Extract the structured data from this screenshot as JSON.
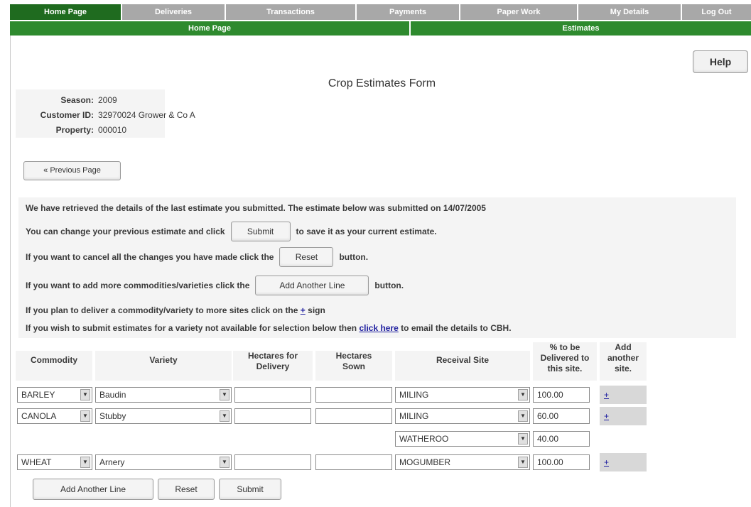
{
  "nav": {
    "tabs": [
      "Home Page",
      "Deliveries",
      "Transactions",
      "Payments",
      "Paper Work",
      "My Details",
      "Log Out"
    ],
    "subtabs": [
      "Home Page",
      "Estimates"
    ]
  },
  "help_label": "Help",
  "title": "Crop Estimates Form",
  "info": {
    "season_label": "Season:",
    "season": "2009",
    "customer_label": "Customer ID:",
    "customer": "32970024 Grower & Co A",
    "property_label": "Property:",
    "property": "000010"
  },
  "prev_label": "« Previous Page",
  "messages": {
    "line1": "We have retrieved the details of the last estimate you submitted. The estimate below was submitted on 14/07/2005",
    "line2a": "You can change your previous estimate and click",
    "line2b": "to save it as your current estimate.",
    "line3a": "If you want to cancel all the changes you have made click the",
    "line3b": "button.",
    "line4a": "If you want to add more commodities/varieties click the",
    "line4b": "button.",
    "line5a": "If you plan to deliver a commodity/variety to more sites click on the",
    "line5b": "+",
    "line5c": "sign",
    "line6a": "If you wish to submit estimates for a variety not available for selection below then",
    "line6b": "click here",
    "line6c": "to email the details to CBH.",
    "submit": "Submit",
    "reset": "Reset",
    "add_line": "Add Another Line"
  },
  "table": {
    "headers": {
      "commodity": "Commodity",
      "variety": "Variety",
      "hect_delivery": "Hectares for Delivery",
      "hect_sown": "Hectares Sown",
      "site": "Receival Site",
      "pct": "% to be Delivered to this site.",
      "add": "Add another site."
    },
    "rows": [
      {
        "commodity": "BARLEY",
        "variety": "Baudin",
        "delivery": "",
        "sown": "",
        "site": "MILING",
        "pct": "100.00",
        "add": "+"
      },
      {
        "commodity": "CANOLA",
        "variety": "Stubby",
        "delivery": "",
        "sown": "",
        "site": "MILING",
        "pct": "60.00",
        "add": "+"
      },
      {
        "commodity": "",
        "variety": "",
        "delivery": "",
        "sown": "",
        "site": "WATHEROO",
        "pct": "40.00",
        "add": ""
      },
      {
        "commodity": "WHEAT",
        "variety": "Arnery",
        "delivery": "",
        "sown": "",
        "site": "MOGUMBER",
        "pct": "100.00",
        "add": "+"
      }
    ]
  },
  "bottom": {
    "add_line": "Add Another Line",
    "reset": "Reset",
    "submit": "Submit"
  }
}
